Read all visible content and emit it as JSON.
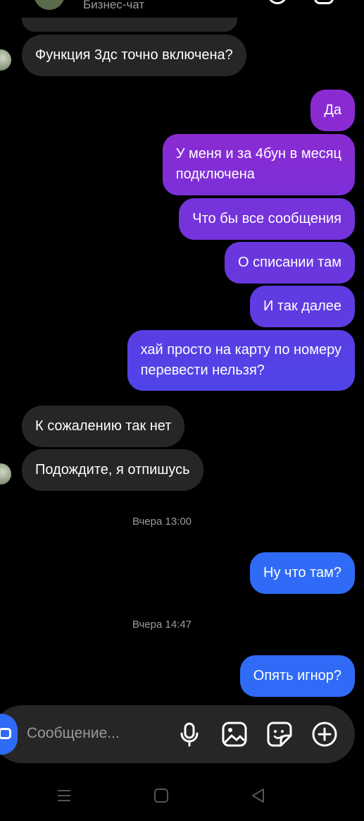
{
  "header": {
    "subtitle": "Бизнес-чат",
    "avatar_icon": "avatar",
    "call_icon": "phone-icon",
    "video_icon": "video-icon"
  },
  "messages": [
    {
      "direction": "in",
      "text": "Функция 3дс точно включена?"
    },
    {
      "direction": "out",
      "text": "Да"
    },
    {
      "direction": "out",
      "line1": "У меня и за 4бун в месяц",
      "line2": "подключена"
    },
    {
      "direction": "out",
      "text": "Что бы все сообщения"
    },
    {
      "direction": "out",
      "text": "О списании там"
    },
    {
      "direction": "out",
      "text": "И так далее"
    },
    {
      "direction": "out",
      "line1": "хай просто на карту по номеру",
      "line2": "перевести нельзя?"
    },
    {
      "direction": "in",
      "text": "К сожалению так нет"
    },
    {
      "direction": "in",
      "text": "Подождите, я отпишусь"
    },
    {
      "direction": "out",
      "text": "Ну что там?"
    },
    {
      "direction": "out",
      "text": "Опять игнор?"
    }
  ],
  "timestamps": [
    "Вчера 13:00",
    "Вчера 14:47"
  ],
  "composer": {
    "placeholder": "Сообщение...",
    "icons": [
      "camera-icon",
      "microphone-icon",
      "image-icon",
      "sticker-icon",
      "plus-icon"
    ]
  },
  "nav_bar": {
    "icons": [
      "menu-icon",
      "home-icon",
      "back-icon"
    ]
  },
  "colors": {
    "background": "#000000",
    "incoming_bubble": "#262626",
    "outgoing_gradient_top": "#8a2bd2",
    "outgoing_gradient_mid": "#6a3ae0",
    "outgoing_gradient_bottom": "#2f6bf6",
    "secondary_text": "#9a9a9a"
  }
}
